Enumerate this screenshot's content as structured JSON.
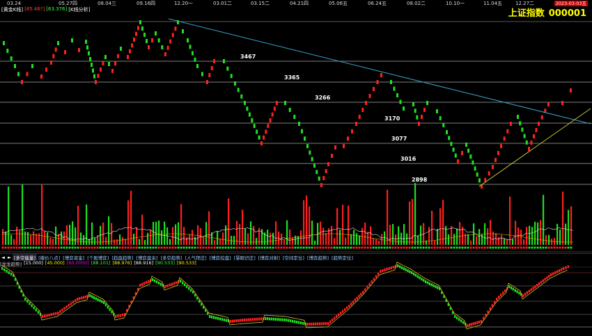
{
  "header": {
    "left_items": [
      {
        "text": "[黄金K线]",
        "color": "#ffffff"
      },
      {
        "text": "[85.46?]",
        "color": "#ff4444"
      },
      {
        "text": "[63.376]",
        "color": "#44ff44"
      },
      {
        "text": "[K线分析]",
        "color": "#ffffff"
      }
    ],
    "index_name": "上证指数",
    "index_code": "000001",
    "date_badge": "2023-03-03五"
  },
  "top_dates": [
    "03.24",
    "05.27四",
    "08.04三",
    "09.16四",
    "12.20一",
    "03.01二",
    "03.15二",
    "04.21四",
    "05.06五",
    "06.24五",
    "08.02二",
    "10.10一",
    "11.04五",
    "12.27二"
  ],
  "levels": [
    {
      "value": "3467"
    },
    {
      "value": "3365"
    },
    {
      "value": "3266"
    },
    {
      "value": "3170"
    },
    {
      "value": "3077"
    },
    {
      "value": "3016"
    },
    {
      "value": "2898"
    }
  ],
  "toolbar": {
    "items": [
      "[多空能量]",
      "[撤价八点]",
      "[博弈资金]",
      "[个股博弈]",
      "[趋盘趋势]",
      "[博弈盘余]",
      "[多空趋势]",
      "[人气拜庄]",
      "[博弈控盘]",
      "[慧眼识庄]",
      "[博弈对射]",
      "[空间定位]",
      "[博弈趋势]",
      "[趋势定位]"
    ]
  },
  "indicator": {
    "items": [
      {
        "text": "[龙龙趋势]",
        "color": "#cccccc"
      },
      {
        "text": "[15.000]",
        "color": "#ffffff"
      },
      {
        "text": "[45.000]",
        "color": "#ffff00"
      },
      {
        "text": "[60.0000]",
        "color": "#ff00ff"
      },
      {
        "text": "[88.101]",
        "color": "#44ff44"
      },
      {
        "text": "[88.976]",
        "color": "#ffff00"
      },
      {
        "text": "[88.916]",
        "color": "#ffffff"
      },
      {
        "text": "[90.533]",
        "color": "#44ff44"
      },
      {
        "text": "[90.533]",
        "color": "#ffff00"
      }
    ]
  },
  "colors": {
    "up": "#ff2020",
    "down": "#20e020",
    "trend": "#3aa6c8",
    "support": "#c8c840"
  }
}
